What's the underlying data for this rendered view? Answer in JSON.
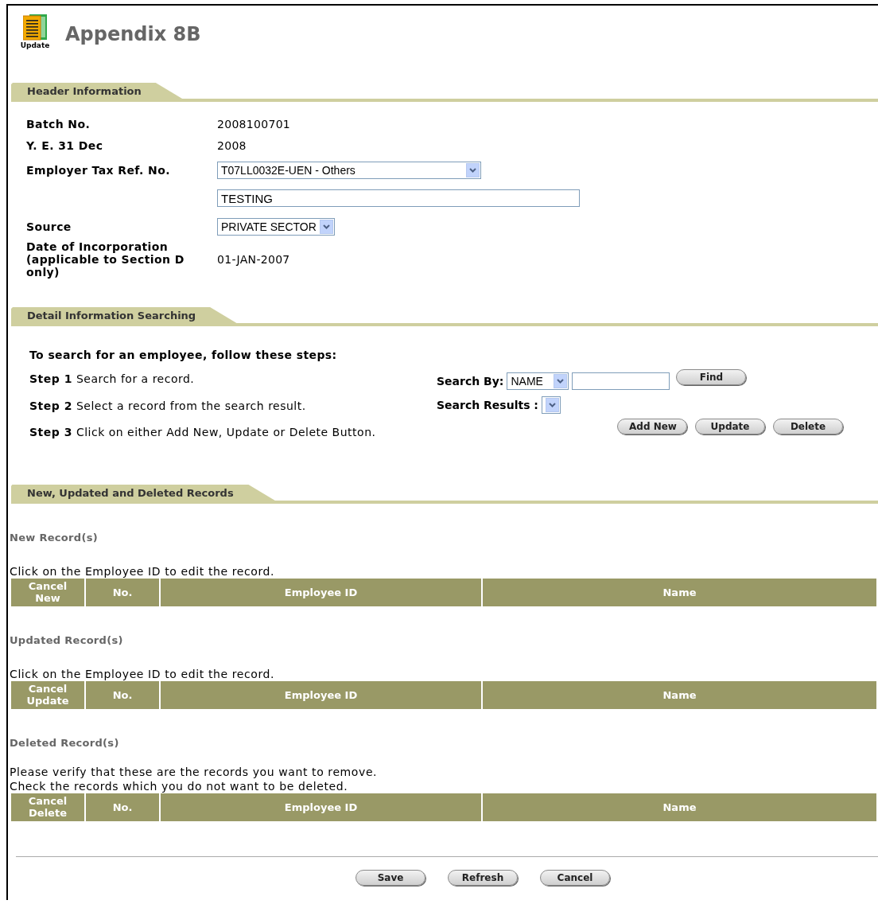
{
  "page": {
    "icon_label": "Update",
    "title": "Appendix 8B"
  },
  "header_section": {
    "heading": "Header Information",
    "fields": [
      {
        "kind": "text",
        "label": "Batch No.",
        "value": "2008100701"
      },
      {
        "kind": "text",
        "label": "Y. E. 31 Dec",
        "value": "2008"
      },
      {
        "kind": "select",
        "label": "Employer Tax Ref. No.",
        "value": "T07LL0032E-UEN - Others"
      },
      {
        "kind": "input",
        "value": "TESTING"
      },
      {
        "kind": "select",
        "label": "Source",
        "value": "PRIVATE SECTOR"
      },
      {
        "kind": "text",
        "label": "Date of Incorporation (applicable to Section D only)",
        "value": "01-JAN-2007"
      }
    ]
  },
  "search_section": {
    "heading": "Detail Information Searching",
    "intro": "To search for an employee, follow these steps:",
    "steps": [
      {
        "step": "Step 1",
        "text": "Search for a record."
      },
      {
        "step": "Step 2",
        "text": "Select a record from the search result."
      },
      {
        "step": "Step 3",
        "text": "Click on either Add New, Update or Delete Button."
      }
    ],
    "search_by": {
      "label": "Search By:",
      "option": "NAME"
    },
    "find_button": "Find",
    "results_label": "Search Results :",
    "actions": [
      "Add New",
      "Update",
      "Delete"
    ]
  },
  "records_section": {
    "heading": "New, Updated and Deleted Records",
    "groups": [
      {
        "title": "New Record(s)",
        "notes": [
          "Click on the Employee ID to edit the record."
        ],
        "columns": [
          "Cancel New",
          "No.",
          "Employee ID",
          "Name"
        ]
      },
      {
        "title": "Updated Record(s)",
        "notes": [
          "Click on the Employee ID to edit the record."
        ],
        "columns": [
          "Cancel Update",
          "No.",
          "Employee ID",
          "Name"
        ]
      },
      {
        "title": "Deleted Record(s)",
        "notes": [
          "Please verify that these are the records you want to remove.",
          "Check the records which you do not want to be deleted."
        ],
        "columns": [
          "Cancel Delete",
          "No.",
          "Employee ID",
          "Name"
        ]
      }
    ]
  },
  "footer_buttons": [
    "Save",
    "Refresh",
    "Cancel"
  ]
}
